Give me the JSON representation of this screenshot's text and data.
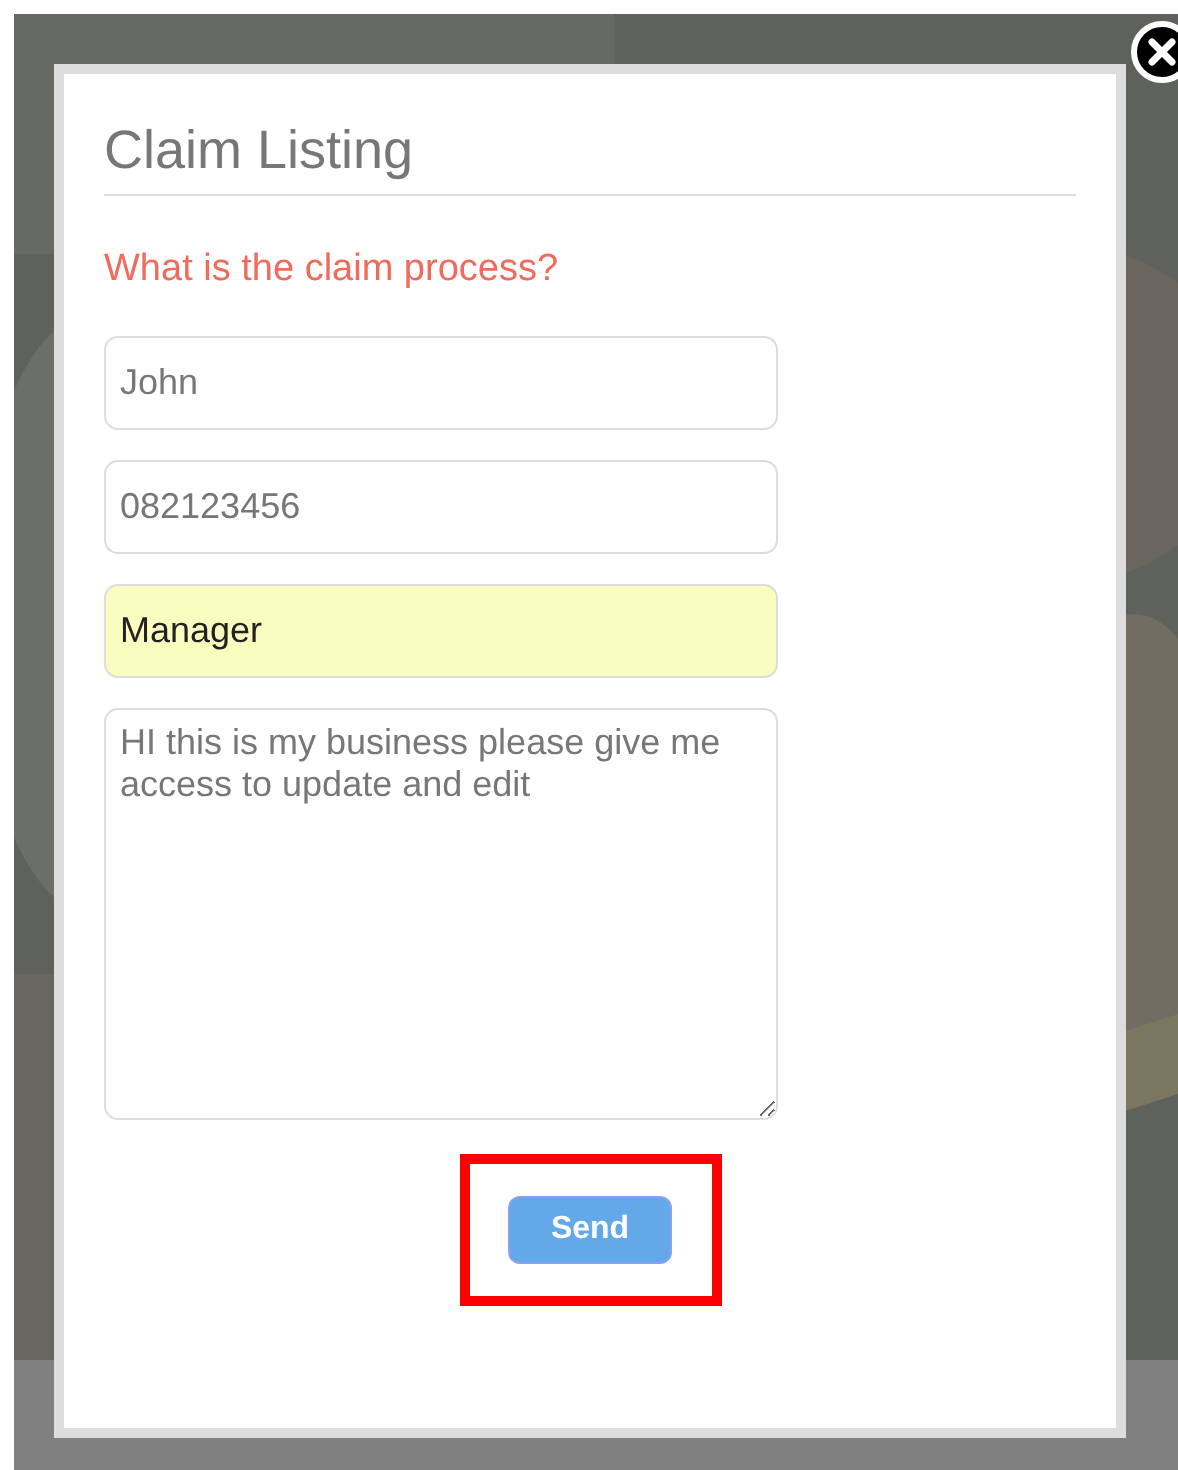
{
  "dialog": {
    "title": "Claim Listing",
    "subtitle": "What is the claim process?",
    "fields": [
      {
        "kind": "input",
        "value": "John",
        "autofilled": false
      },
      {
        "kind": "input",
        "value": "082123456",
        "autofilled": false
      },
      {
        "kind": "input",
        "value": "Manager",
        "autofilled": true
      },
      {
        "kind": "textarea",
        "value": "HI this is my business please give me access to update and edit",
        "autofilled": false
      }
    ],
    "button": {
      "label": "Send",
      "highlighted": true
    }
  }
}
